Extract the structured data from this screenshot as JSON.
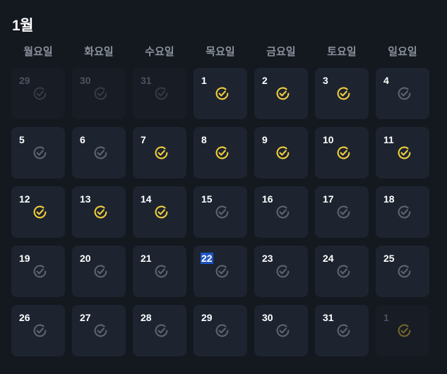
{
  "calendar": {
    "month_label": "1월",
    "weekdays": [
      "월요일",
      "화요일",
      "수요일",
      "목요일",
      "금요일",
      "토요일",
      "일요일"
    ],
    "colors": {
      "checked": "#f1cd3b",
      "unchecked": "#5c6470",
      "outside_unchecked": "#373d47",
      "outside_checked": "#7a6a2c",
      "today_highlight": "#1f54c7"
    },
    "weeks": [
      [
        {
          "day": "29",
          "outside": true,
          "checked": false
        },
        {
          "day": "30",
          "outside": true,
          "checked": false
        },
        {
          "day": "31",
          "outside": true,
          "checked": false
        },
        {
          "day": "1",
          "outside": false,
          "checked": true
        },
        {
          "day": "2",
          "outside": false,
          "checked": true
        },
        {
          "day": "3",
          "outside": false,
          "checked": true
        },
        {
          "day": "4",
          "outside": false,
          "checked": false
        }
      ],
      [
        {
          "day": "5",
          "outside": false,
          "checked": false
        },
        {
          "day": "6",
          "outside": false,
          "checked": false
        },
        {
          "day": "7",
          "outside": false,
          "checked": true
        },
        {
          "day": "8",
          "outside": false,
          "checked": true
        },
        {
          "day": "9",
          "outside": false,
          "checked": true
        },
        {
          "day": "10",
          "outside": false,
          "checked": true
        },
        {
          "day": "11",
          "outside": false,
          "checked": true
        }
      ],
      [
        {
          "day": "12",
          "outside": false,
          "checked": true
        },
        {
          "day": "13",
          "outside": false,
          "checked": true
        },
        {
          "day": "14",
          "outside": false,
          "checked": true
        },
        {
          "day": "15",
          "outside": false,
          "checked": false
        },
        {
          "day": "16",
          "outside": false,
          "checked": false
        },
        {
          "day": "17",
          "outside": false,
          "checked": false
        },
        {
          "day": "18",
          "outside": false,
          "checked": false
        }
      ],
      [
        {
          "day": "19",
          "outside": false,
          "checked": false
        },
        {
          "day": "20",
          "outside": false,
          "checked": false
        },
        {
          "day": "21",
          "outside": false,
          "checked": false
        },
        {
          "day": "22",
          "outside": false,
          "checked": false,
          "today": true
        },
        {
          "day": "23",
          "outside": false,
          "checked": false
        },
        {
          "day": "24",
          "outside": false,
          "checked": false
        },
        {
          "day": "25",
          "outside": false,
          "checked": false
        }
      ],
      [
        {
          "day": "26",
          "outside": false,
          "checked": false
        },
        {
          "day": "27",
          "outside": false,
          "checked": false
        },
        {
          "day": "28",
          "outside": false,
          "checked": false
        },
        {
          "day": "29",
          "outside": false,
          "checked": false
        },
        {
          "day": "30",
          "outside": false,
          "checked": false
        },
        {
          "day": "31",
          "outside": false,
          "checked": false
        },
        {
          "day": "1",
          "outside": true,
          "checked": true
        }
      ]
    ]
  }
}
